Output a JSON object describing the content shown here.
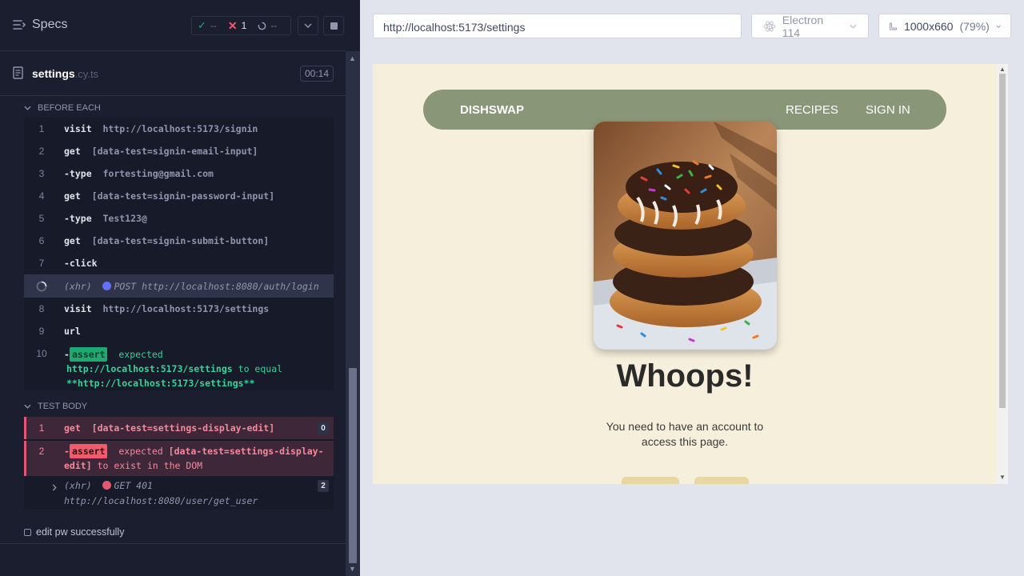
{
  "specs_panel": {
    "title": "Specs",
    "stats": {
      "passed": "--",
      "failed": "1",
      "pending": "--"
    },
    "spec_file": {
      "name": "settings",
      "ext": ".cy.ts",
      "duration": "00:14"
    }
  },
  "before_each": {
    "label": "BEFORE EACH",
    "commands": [
      {
        "num": "1",
        "name": "visit",
        "message": "http://localhost:5173/signin"
      },
      {
        "num": "2",
        "name": "get",
        "message": "[data-test=signin-email-input]"
      },
      {
        "num": "3",
        "name": "-type",
        "message": "fortesting@gmail.com"
      },
      {
        "num": "4",
        "name": "get",
        "message": "[data-test=signin-password-input]"
      },
      {
        "num": "5",
        "name": "-type",
        "message": "Test123@"
      },
      {
        "num": "6",
        "name": "get",
        "message": "[data-test=signin-submit-button]"
      },
      {
        "num": "7",
        "name": "-click",
        "message": ""
      }
    ],
    "xhr": {
      "name": "(xhr)",
      "method": "POST",
      "url": "http://localhost:8080/auth/login"
    },
    "after_xhr": [
      {
        "num": "8",
        "name": "visit",
        "message": "http://localhost:5173/settings"
      },
      {
        "num": "9",
        "name": "url",
        "message": ""
      }
    ],
    "assert": {
      "num": "10",
      "prefix": "-",
      "badge": "assert",
      "word": "expected",
      "actual": "http://localhost:5173/settings",
      "middle": "to equal",
      "expected": "**http://localhost:5173/settings**"
    }
  },
  "test_body": {
    "label": "TEST BODY",
    "get": {
      "num": "1",
      "name": "get",
      "message": "[data-test=settings-display-edit]",
      "count": "0"
    },
    "assert": {
      "num": "2",
      "prefix": "-",
      "badge": "assert",
      "word": "expected",
      "line1_tail": "[data-test=settings-display-",
      "line2_bold": "edit]",
      "line2_tail": "to exist in the DOM"
    },
    "xhr": {
      "name": "(xhr)",
      "method": "GET 401",
      "url": "http://localhost:8080/user/get_user",
      "count": "2"
    }
  },
  "pending_test": {
    "title": "edit pw successfully"
  },
  "browser": {
    "url": "http://localhost:5173/settings",
    "name": "Electron 114",
    "viewport": "1000x660",
    "zoom": "(79%)"
  },
  "app": {
    "brand": "DISHSWAP",
    "nav": [
      "RECIPES",
      "SIGN IN"
    ],
    "headline": "Whoops!",
    "message": "You need to have an account to access this page.",
    "colors": {
      "nav": "#8a9678",
      "background": "#f6efdc"
    }
  }
}
